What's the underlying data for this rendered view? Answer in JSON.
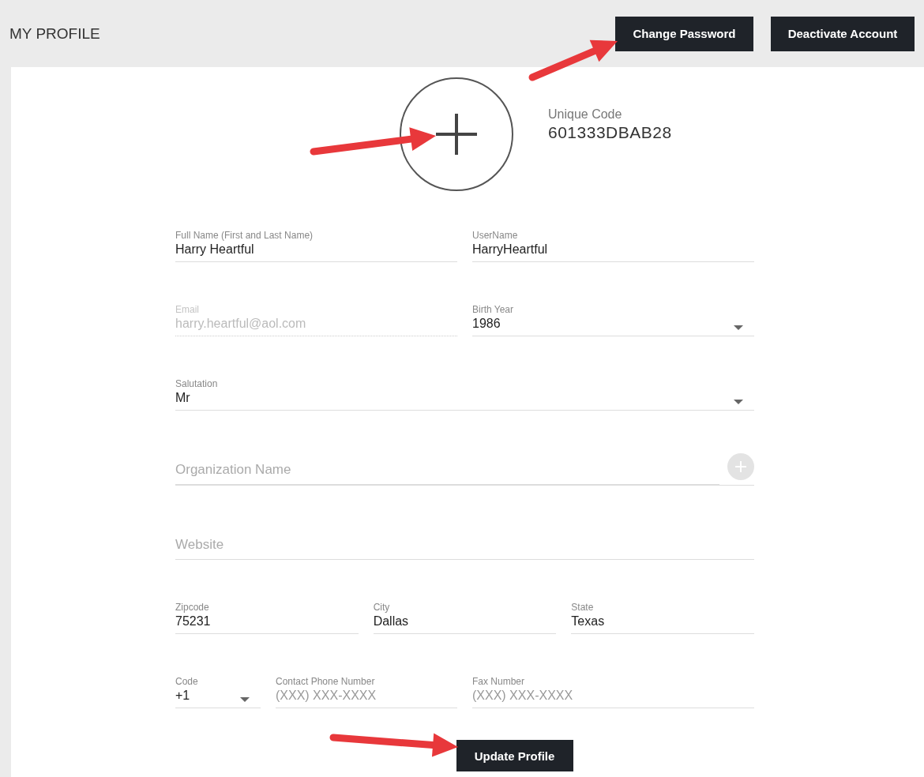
{
  "header": {
    "title": "MY PROFILE",
    "buttons": [
      "Change Password",
      "Deactivate Account"
    ]
  },
  "profile": {
    "unique_code_label": "Unique Code",
    "unique_code": "601333DBAB28"
  },
  "rows": [
    {
      "kind": "normal",
      "fields": [
        {
          "kind": "text",
          "label": "Full Name (First and Last Name)",
          "value": "Harry Heartful",
          "disabled": false
        },
        {
          "kind": "text",
          "label": "UserName",
          "value": "HarryHeartful",
          "disabled": false
        }
      ]
    },
    {
      "kind": "normal",
      "fields": [
        {
          "kind": "text",
          "label": "Email",
          "value": "harry.heartful@aol.com",
          "disabled": true
        },
        {
          "kind": "select",
          "label": "Birth Year",
          "value": "1986",
          "disabled": false
        }
      ]
    },
    {
      "kind": "normal",
      "fields": [
        {
          "kind": "select",
          "label": "Salutation",
          "value": "Mr",
          "disabled": false
        }
      ]
    },
    {
      "kind": "normal",
      "fields": [
        {
          "kind": "empty",
          "placeholder": "Organization Name",
          "add_button": true,
          "disabled": false
        }
      ]
    },
    {
      "kind": "normal",
      "fields": [
        {
          "kind": "empty",
          "placeholder": "Website",
          "disabled": false
        }
      ]
    },
    {
      "kind": "normal",
      "fields": [
        {
          "kind": "text",
          "label": "Zipcode",
          "value": "75231",
          "disabled": false
        },
        {
          "kind": "text",
          "label": "City",
          "value": "Dallas",
          "disabled": false
        },
        {
          "kind": "text",
          "label": "State",
          "value": "Texas",
          "disabled": false
        }
      ]
    },
    {
      "kind": "phone",
      "fields": [
        {
          "kind": "select",
          "label": "Code",
          "value": "+1",
          "disabled": false
        },
        {
          "kind": "text",
          "label": "Contact Phone Number",
          "placeholder": "(XXX) XXX-XXXX",
          "disabled": false
        },
        {
          "kind": "text",
          "label": "Fax Number",
          "placeholder": "(XXX) XXX-XXXX",
          "disabled": false
        }
      ]
    }
  ],
  "submit": "Update Profile"
}
